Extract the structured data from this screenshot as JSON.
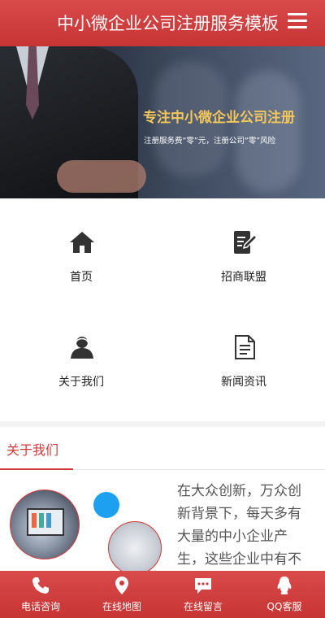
{
  "header": {
    "title": "中小微企业公司注册服务模板",
    "menu_icon": "hamburger-menu-icon"
  },
  "banner": {
    "slogan": "专注中小微企业公司注册",
    "subtitle": "注册服务费“零”元，注册公司“零”风险"
  },
  "nav": [
    {
      "label": "首页",
      "icon": "home-icon"
    },
    {
      "label": "招商联盟",
      "icon": "edit-document-icon"
    },
    {
      "label": "关于我们",
      "icon": "user-icon"
    },
    {
      "label": "新闻资讯",
      "icon": "document-icon"
    }
  ],
  "about": {
    "title": "关于我们",
    "text": "在大众创新，万众创新背景下，每天多有大量的中小企业产生，这些企业中有不"
  },
  "footer": [
    {
      "label": "电话咨询",
      "icon": "phone-icon"
    },
    {
      "label": "在线地图",
      "icon": "map-pin-icon"
    },
    {
      "label": "在线留言",
      "icon": "chat-icon"
    },
    {
      "label": "QQ客服",
      "icon": "qq-penguin-icon"
    }
  ],
  "colors": {
    "brand_red": "#d23a3a",
    "slogan_gold": "#f3c75b",
    "accent_blue": "#1ea0f0"
  }
}
